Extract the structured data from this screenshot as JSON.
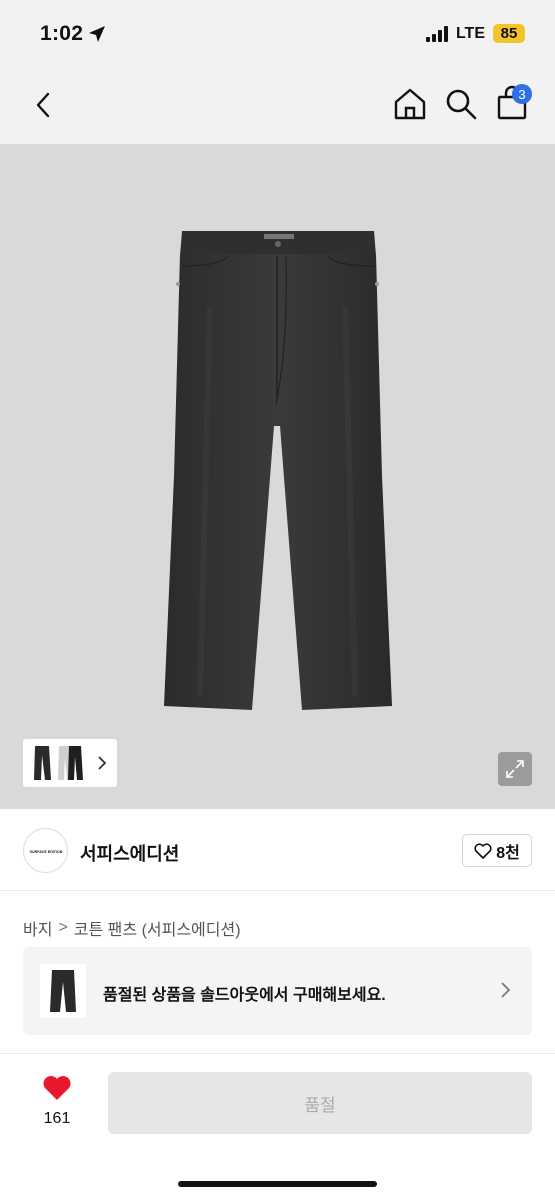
{
  "status_bar": {
    "time": "1:02",
    "network": "LTE",
    "battery": "85"
  },
  "nav": {
    "back_icon": "chevron-left-icon",
    "home_icon": "home-icon",
    "search_icon": "search-icon",
    "bag_icon": "shopping-bag-icon",
    "bag_count": "3"
  },
  "product": {
    "image": "black denim jeans",
    "thumbnail_icon": "chevron-right-icon",
    "expand_icon": "expand-icon"
  },
  "brand": {
    "logo_text": "SURFACE EDITION",
    "name": "서피스에디션",
    "like_label": "8천"
  },
  "breadcrumb": {
    "category": "바지",
    "separator": ">",
    "item": "코튼 팬츠 (서피스에디션)"
  },
  "soldout": {
    "message": "품절된 상품을 솔드아웃에서 구매해보세요."
  },
  "bottom_bar": {
    "like_count": "161",
    "buy_label": "품절"
  },
  "colors": {
    "accent_blue": "#2f6fe8",
    "heart_red": "#e8192c",
    "battery_yellow": "#f3c52a",
    "hero_bg": "#d9d9d9"
  }
}
